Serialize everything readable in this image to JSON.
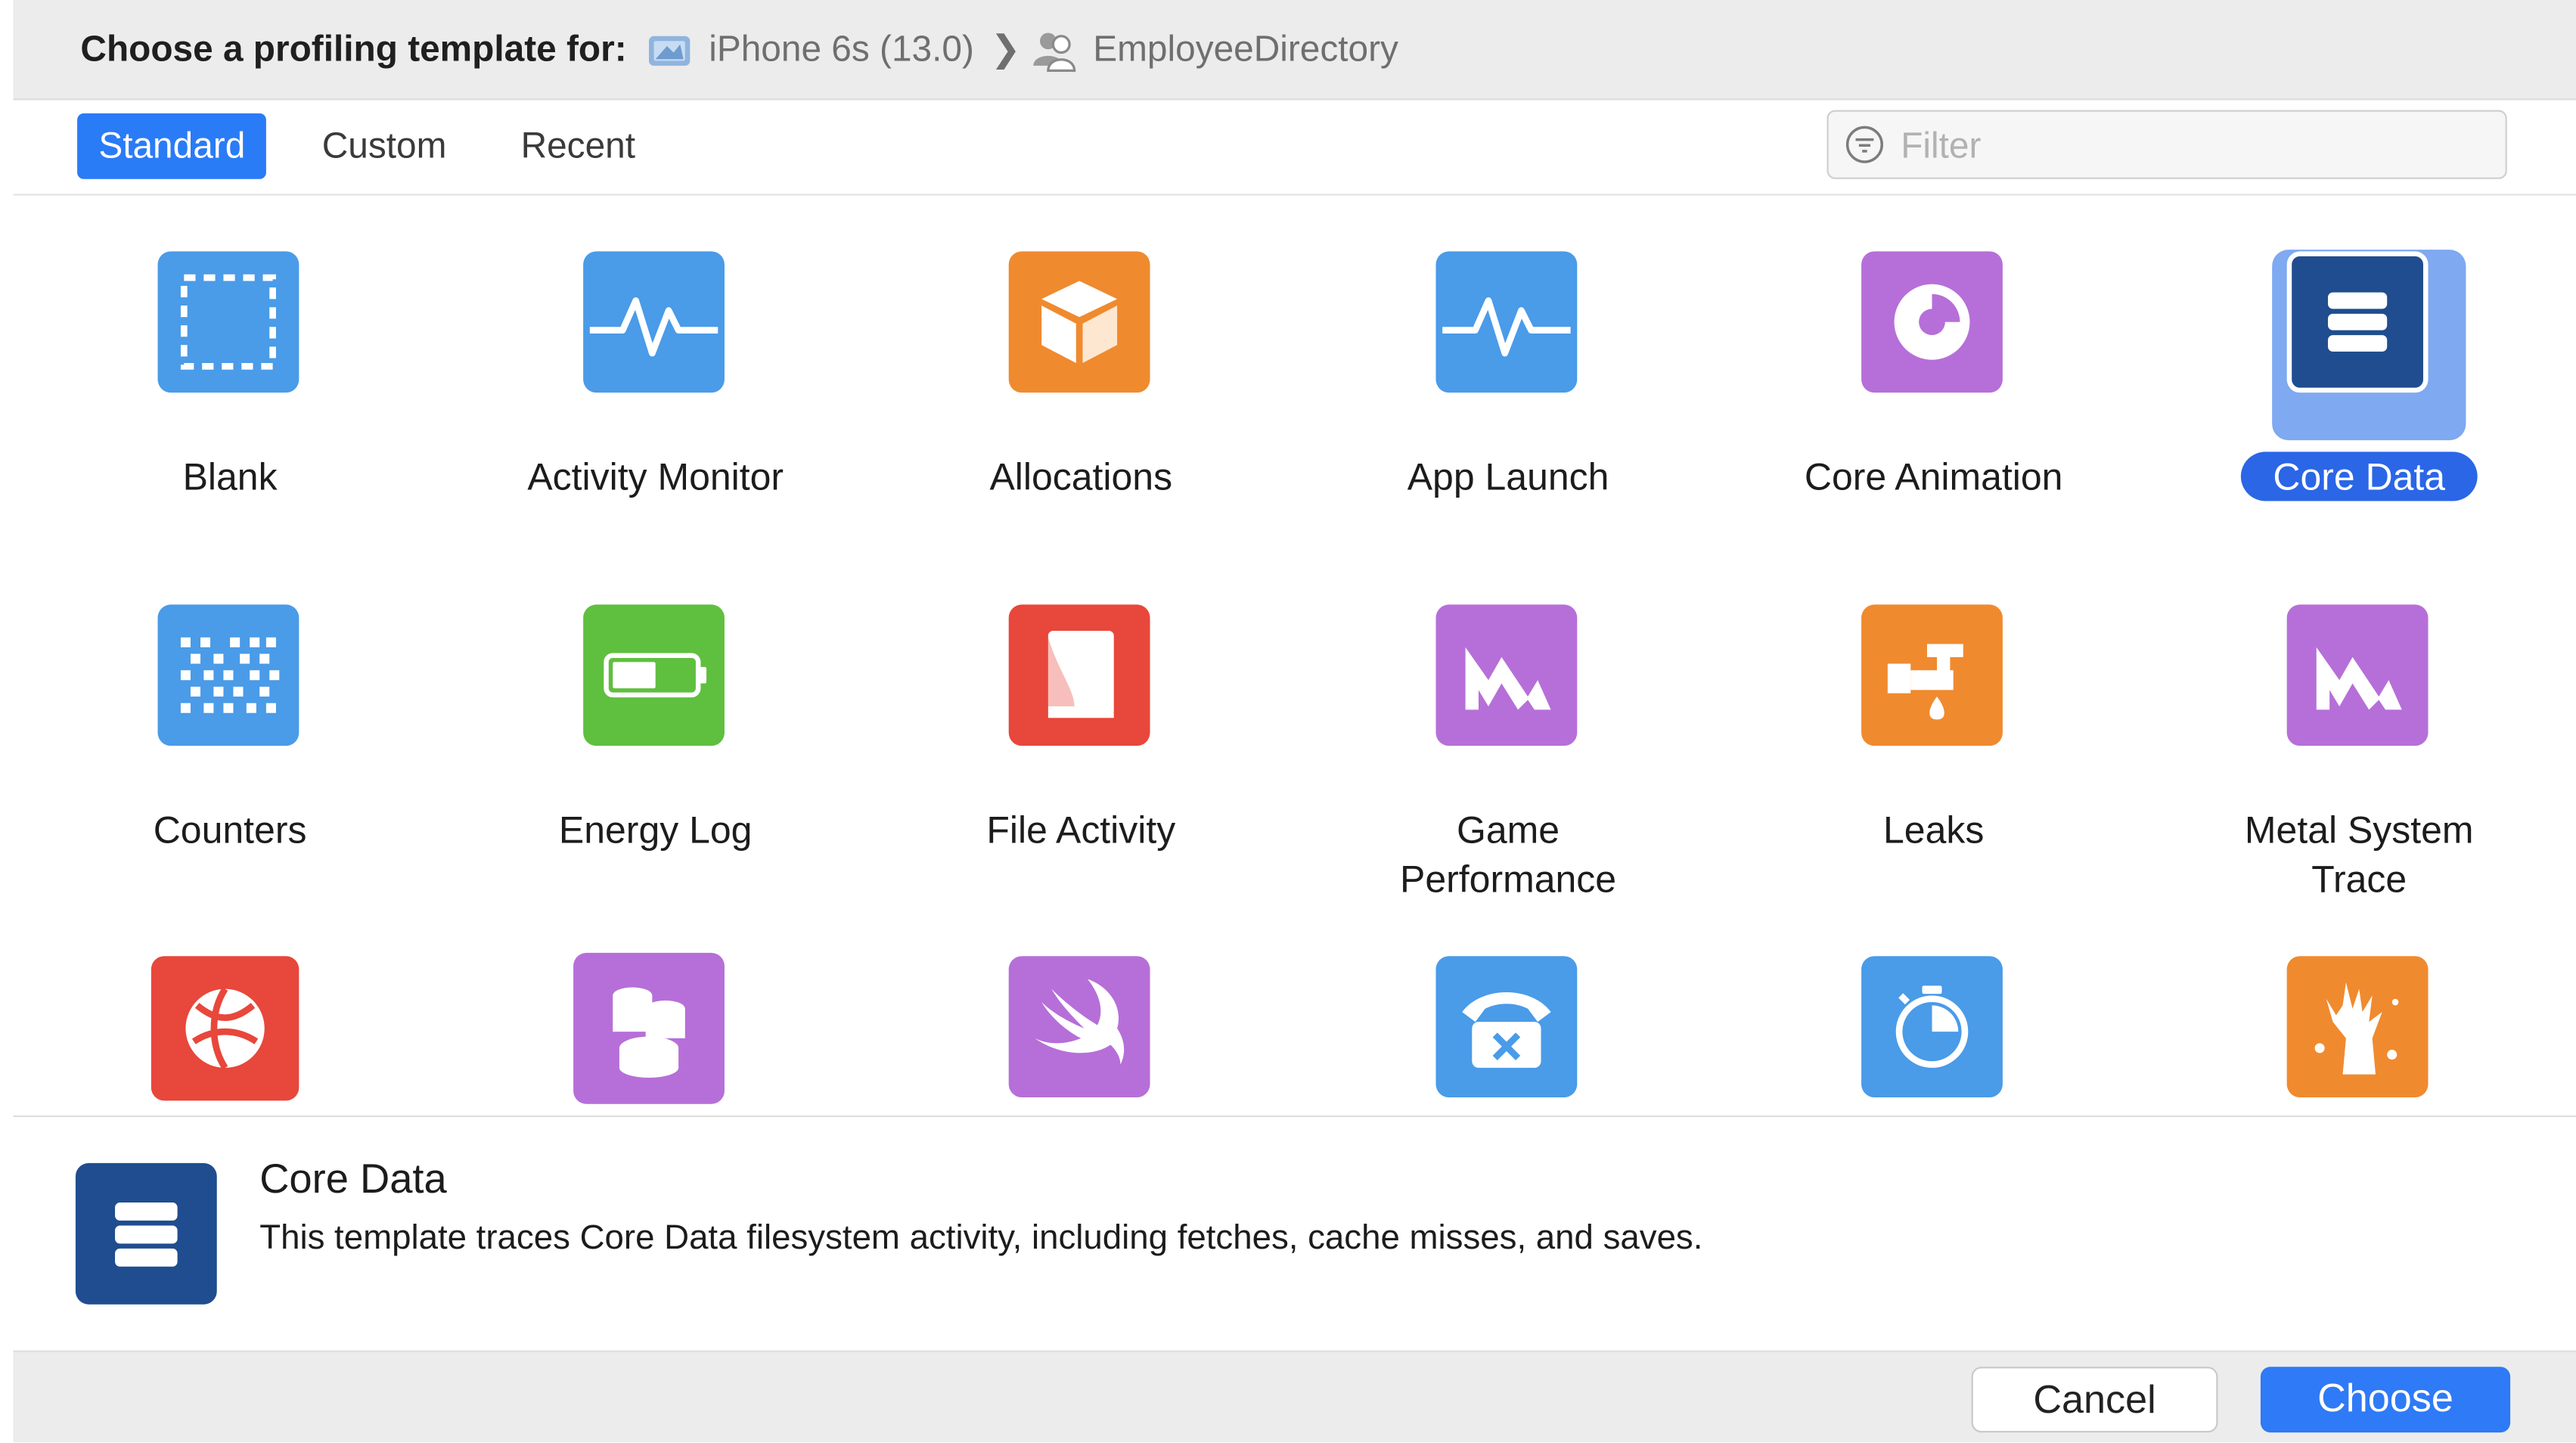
{
  "header": {
    "prefix": "Choose a profiling template for:",
    "device": "iPhone 6s (13.0)",
    "separator": "❯",
    "app": "EmployeeDirectory"
  },
  "tabs": [
    {
      "label": "Standard",
      "active": true
    },
    {
      "label": "Custom",
      "active": false
    },
    {
      "label": "Recent",
      "active": false
    }
  ],
  "filter": {
    "placeholder": "Filter",
    "value": ""
  },
  "templates": [
    {
      "label": "Blank",
      "color": "#4a9be8",
      "icon": "blank-icon"
    },
    {
      "label": "Activity Monitor",
      "color": "#4a9be8",
      "icon": "activity-monitor-icon"
    },
    {
      "label": "Allocations",
      "color": "#f08a2e",
      "icon": "allocations-icon"
    },
    {
      "label": "App Launch",
      "color": "#4a9be8",
      "icon": "app-launch-icon"
    },
    {
      "label": "Core Animation",
      "color": "#b66fd8",
      "icon": "core-animation-icon"
    },
    {
      "label": "Core Data",
      "color": "#1f4d8f",
      "icon": "core-data-icon",
      "selected": true
    },
    {
      "label": "Counters",
      "color": "#4a9be8",
      "icon": "counters-icon"
    },
    {
      "label": "Energy Log",
      "color": "#5fbf3f",
      "icon": "energy-log-icon"
    },
    {
      "label": "File Activity",
      "color": "#e8473b",
      "icon": "file-activity-icon"
    },
    {
      "label": "Game Performance",
      "color": "#b66fd8",
      "icon": "game-performance-icon"
    },
    {
      "label": "Leaks",
      "color": "#f08a2e",
      "icon": "leaks-icon"
    },
    {
      "label": "Metal System Trace",
      "color": "#b66fd8",
      "icon": "metal-system-trace-icon"
    },
    {
      "label": "",
      "color": "#e8473b",
      "icon": "network-icon"
    },
    {
      "label": "",
      "color": "#b66fd8",
      "icon": "database-icon"
    },
    {
      "label": "",
      "color": "#b66fd8",
      "icon": "swift-icon"
    },
    {
      "label": "",
      "color": "#4a9be8",
      "icon": "telephone-icon"
    },
    {
      "label": "",
      "color": "#4a9be8",
      "icon": "timer-icon"
    },
    {
      "label": "",
      "color": "#f08a2e",
      "icon": "zombie-hand-icon"
    }
  ],
  "detail": {
    "title": "Core Data",
    "description": "This template traces Core Data filesystem activity, including fetches, cache misses, and saves."
  },
  "buttons": {
    "cancel": "Cancel",
    "choose": "Choose"
  }
}
